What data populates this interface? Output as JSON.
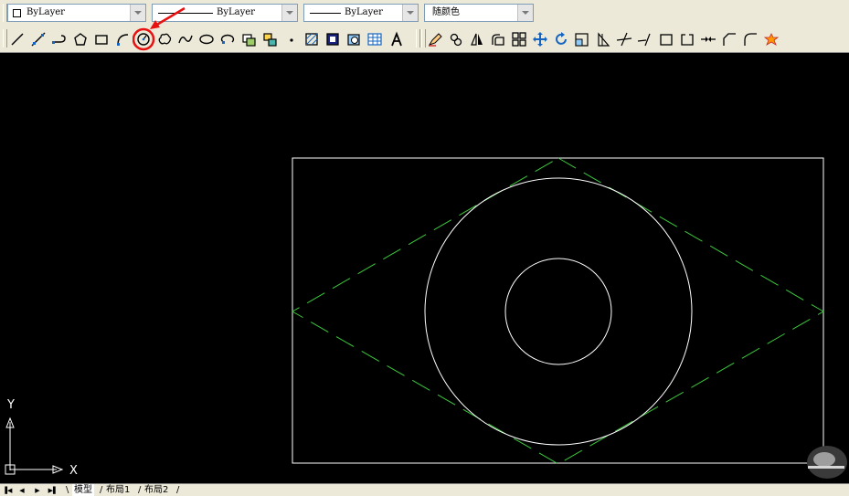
{
  "properties": {
    "layer": "ByLayer",
    "linetype": "ByLayer",
    "lineweight": "ByLayer",
    "color": "随颜色"
  },
  "draw_tools": [
    "line-icon",
    "construction-line-icon",
    "polyline-icon",
    "polygon-icon",
    "rectangle-icon",
    "arc-icon",
    "circle-icon",
    "revision-cloud-icon",
    "spline-icon",
    "ellipse-icon",
    "ellipse-arc-icon",
    "insert-block-icon",
    "make-block-icon",
    "point-icon",
    "hatch-icon",
    "gradient-icon",
    "region-icon",
    "table-icon",
    "multiline-text-icon"
  ],
  "modify_tools": [
    "erase-icon",
    "copy-icon",
    "mirror-icon",
    "offset-icon",
    "array-icon",
    "move-icon",
    "rotate-icon",
    "scale-icon",
    "stretch-icon",
    "trim-icon",
    "extend-icon",
    "break-at-point-icon",
    "break-icon",
    "join-icon",
    "chamfer-icon",
    "fillet-icon",
    "explode-icon"
  ],
  "highlighted_tool": "circle-icon",
  "colors": {
    "toolbar_bg": "#ece9d8",
    "canvas_bg": "#000000",
    "object_white": "#ffffff",
    "dashed_green": "#3cc83c",
    "annotation_red": "#e81010"
  },
  "ucs": {
    "x_label": "X",
    "y_label": "Y"
  },
  "tabs": {
    "model": "模型",
    "layout1": "布局1",
    "layout2": "布局2"
  }
}
